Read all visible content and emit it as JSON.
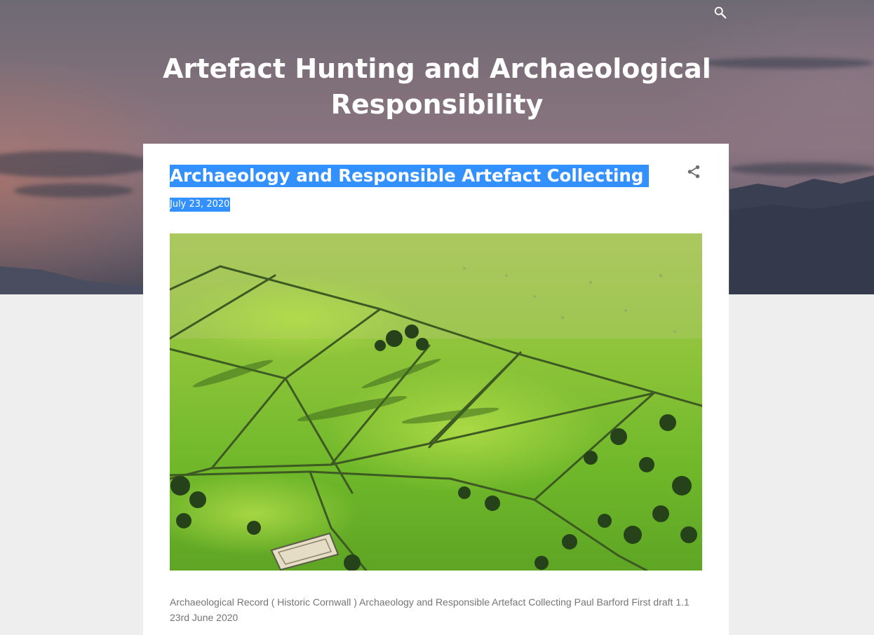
{
  "header": {
    "blog_title": "Artefact Hunting and Archaeological Responsibility",
    "search_icon": "search-icon"
  },
  "post": {
    "title": "Archaeology and Responsible Artefact Collecting",
    "date": "July 23, 2020",
    "share_icon": "share-icon",
    "image_description_alt": "Archaeological Record ( Historic Cornwall )",
    "caption": "Archaeological Record ( Historic Cornwall )  Archaeology and Responsible Artefact Collecting Paul Barford First draft 1.1 23rd June 2020"
  },
  "colors": {
    "selection_highlight": "#3390ff",
    "page_background": "#eeeeee",
    "caption_text": "#757575",
    "header_text": "#ffffff"
  }
}
